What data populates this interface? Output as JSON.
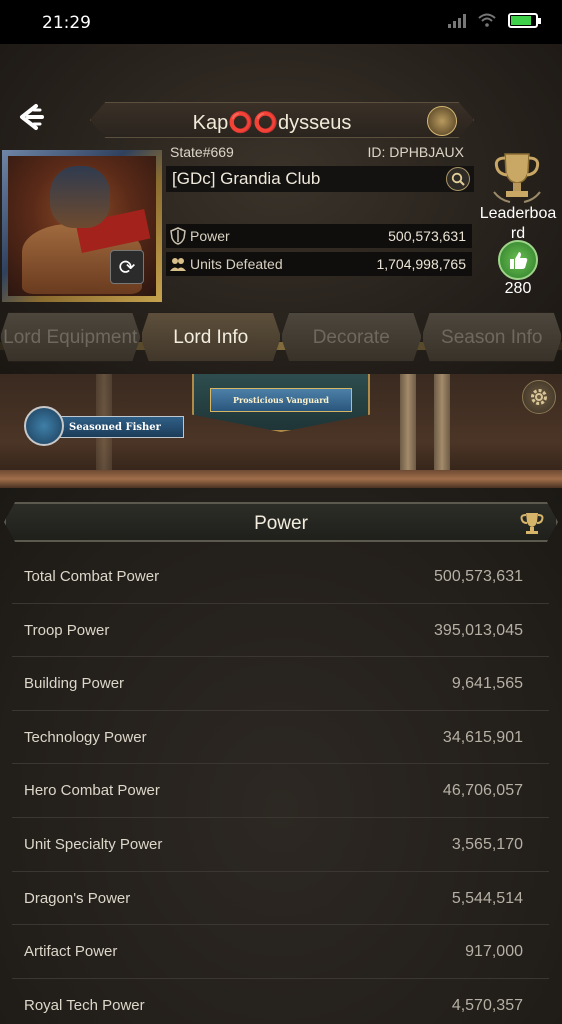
{
  "status_bar": {
    "time": "21:29"
  },
  "profile": {
    "name": "Kap⭕⭕dysseus",
    "state": "State#669",
    "id": "ID: DPHBJAUX",
    "alliance": "[GDc] Grandia Club",
    "stats": [
      {
        "label": "Power",
        "value": "500,573,631",
        "icon": "shield-icon"
      },
      {
        "label": "Units Defeated",
        "value": "1,704,998,765",
        "icon": "troops-icon"
      }
    ],
    "leaderboard_label": "Leaderboa rd",
    "likes": "280"
  },
  "tabs": [
    {
      "label": "Lord Equipment",
      "active": false
    },
    {
      "label": "Lord Info",
      "active": true
    },
    {
      "label": "Decorate",
      "active": false
    },
    {
      "label": "Season Info",
      "active": false
    }
  ],
  "banner": {
    "title": "Prosticious Vanguard",
    "badge": "Seasoned Fisher"
  },
  "power_section": {
    "title": "Power",
    "rows": [
      {
        "label": "Total Combat Power",
        "value": "500,573,631"
      },
      {
        "label": "Troop Power",
        "value": "395,013,045"
      },
      {
        "label": "Building Power",
        "value": "9,641,565"
      },
      {
        "label": "Technology Power",
        "value": "34,615,901"
      },
      {
        "label": "Hero Combat Power",
        "value": "46,706,057"
      },
      {
        "label": "Unit Specialty Power",
        "value": "3,565,170"
      },
      {
        "label": "Dragon's Power",
        "value": "5,544,514"
      },
      {
        "label": "Artifact Power",
        "value": "917,000"
      },
      {
        "label": "Royal Tech Power",
        "value": "4,570,357"
      }
    ]
  },
  "colors": {
    "accent_gold": "#b08b47",
    "like_green": "#3e9a36",
    "battery_green": "#3fd14a"
  }
}
